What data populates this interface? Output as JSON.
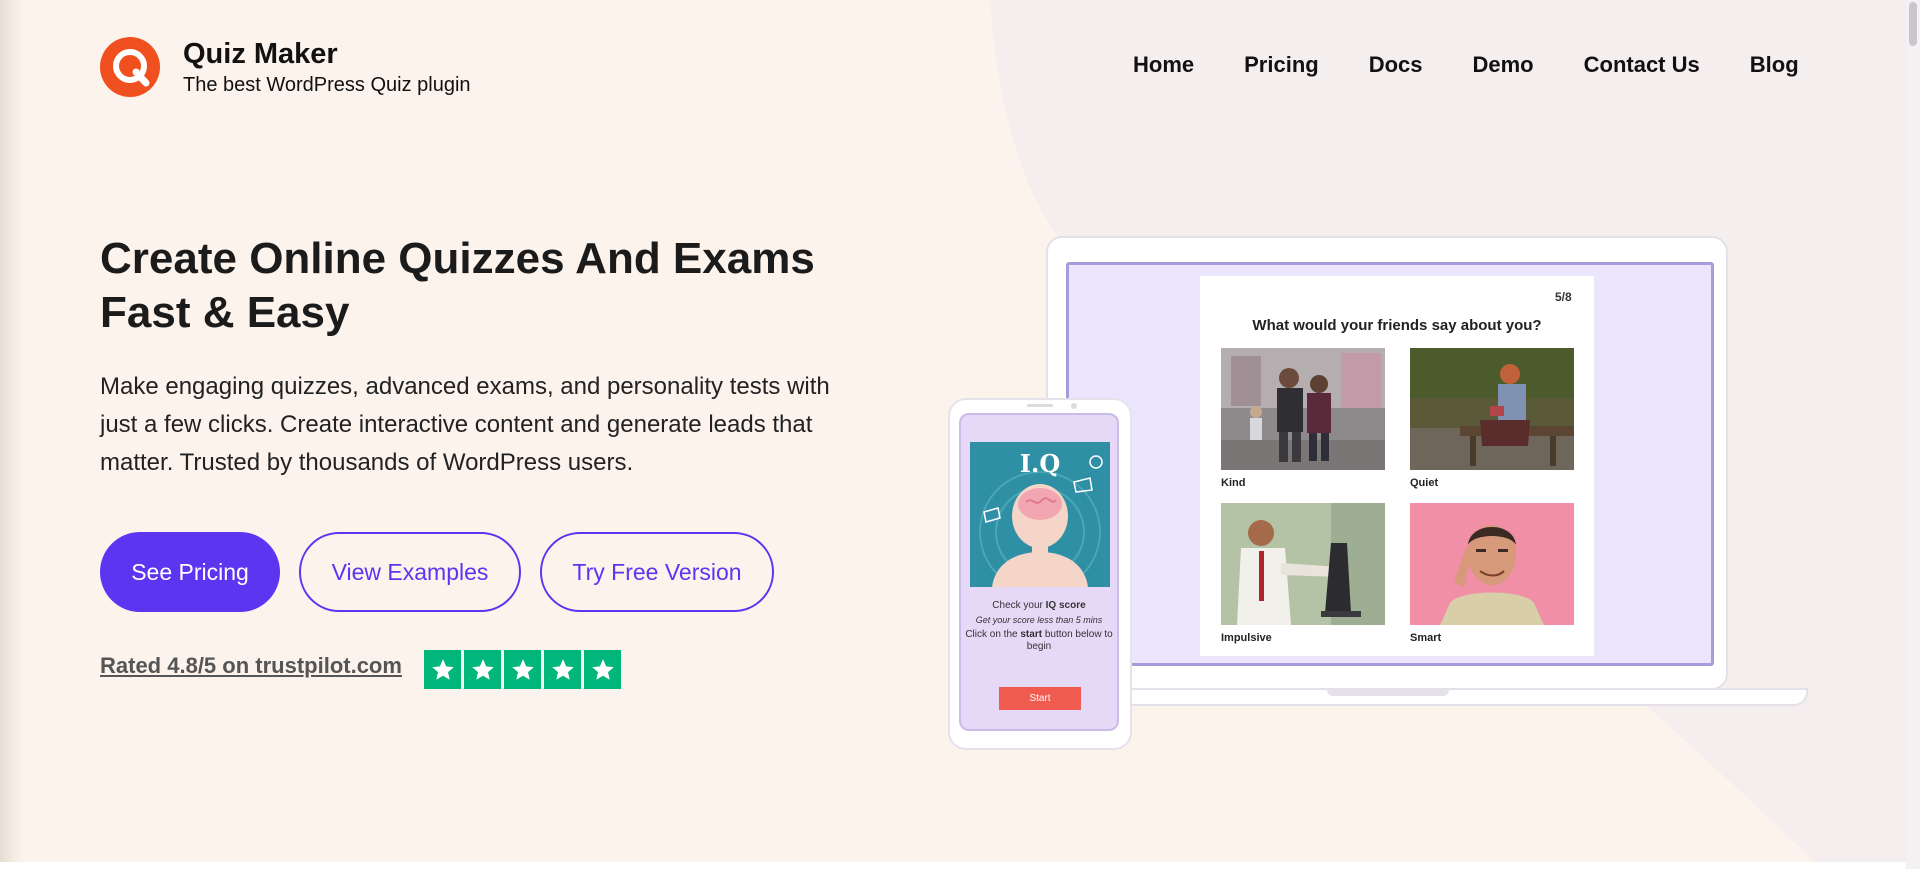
{
  "brand": {
    "name": "Quiz Maker",
    "tagline": "The best WordPress Quiz plugin",
    "logo_icon": "quiz-maker-logo-icon",
    "accent_color": "#f0501f"
  },
  "nav": {
    "items": [
      {
        "label": "Home"
      },
      {
        "label": "Pricing"
      },
      {
        "label": "Docs"
      },
      {
        "label": "Demo"
      },
      {
        "label": "Contact Us"
      },
      {
        "label": "Blog"
      }
    ]
  },
  "hero": {
    "title": "Create Online Quizzes And Exams Fast & Easy",
    "description": "Make engaging quizzes, advanced exams, and personality tests with just a few clicks. Create interactive content and generate leads that matter. Trusted by thousands of WordPress users.",
    "buttons": {
      "primary": "See Pricing",
      "examples": "View Examples",
      "free": "Try Free Version"
    },
    "primary_color": "#5b35f0",
    "rating_text": "Rated 4.8/5 on trustpilot.com",
    "stars_shown": 5,
    "star_color": "#00b67a"
  },
  "laptop_quiz": {
    "counter": "5/8",
    "question": "What would your friends say about you?",
    "options": [
      {
        "label": "Kind"
      },
      {
        "label": "Quiet"
      },
      {
        "label": "Impulsive"
      },
      {
        "label": "Smart"
      }
    ]
  },
  "phone_quiz": {
    "title": "I.Q",
    "line1_prefix": "Check your ",
    "line1_bold": "IQ score",
    "line2": "Get your score less than 5 mins",
    "line3_prefix": "Click on the ",
    "line3_bold": "start",
    "line3_suffix": " button below to begin",
    "start_label": "Start"
  }
}
